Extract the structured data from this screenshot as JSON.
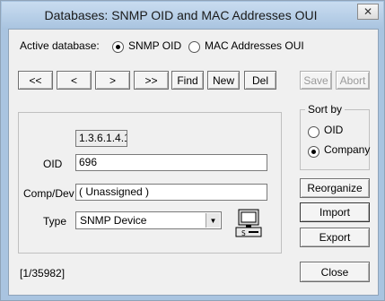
{
  "window": {
    "title": "Databases: SNMP OID and MAC Addresses OUI",
    "close_glyph": "✕"
  },
  "active_db": {
    "label": "Active database:",
    "options": [
      {
        "label": "SNMP OID",
        "selected": true
      },
      {
        "label": "MAC Addresses OUI",
        "selected": false
      }
    ]
  },
  "toolbar": {
    "first": "<<",
    "prev": "<",
    "next": ">",
    "last": ">>",
    "find": "Find",
    "new": "New",
    "del": "Del",
    "save": "Save",
    "abort": "Abort"
  },
  "record": {
    "prefix": "1.3.6.1.4.1.",
    "oid_label": "OID",
    "oid_value": "696",
    "comp_label": "Comp/Dev",
    "comp_value": "( Unassigned )",
    "type_label": "Type",
    "type_value": "SNMP Device",
    "type_icon": "computer-icon"
  },
  "sort": {
    "title": "Sort by",
    "options": [
      {
        "label": "OID",
        "selected": false
      },
      {
        "label": "Company",
        "selected": true
      }
    ]
  },
  "actions": {
    "reorganize": "Reorganize",
    "import": "Import",
    "export": "Export",
    "close": "Close"
  },
  "status": {
    "position": "[1/35982]"
  }
}
